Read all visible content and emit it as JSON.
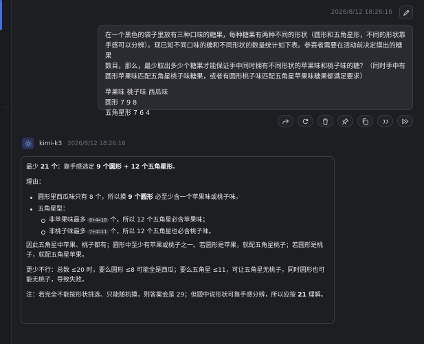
{
  "user_message": {
    "timestamp": "2026/8/12 18:26:16",
    "lines": [
      "在一个黑色的袋子里放有三种口味的糖果，每种糖果有两种不同的形状（圆形和五角星形，不同的形状靠",
      "手感可以分辨）。现已知不同口味的糖和不同形状的数量统计如下表。参赛者需要在活动前决定摸出的糖果",
      "数目，那么，最少取出多少个糖果才能保证手中同时拥有不同形状的苹果味和桃子味的糖？（同时手中有",
      "圆形苹果味匹配五角星桃子味糖果，或者有圆形桃子味匹配五角星苹果味糖果都满足要求）"
    ],
    "table_lines": [
      "苹果味 桃子味 西瓜味",
      "圆形 7 9 8",
      "五角星形 7 6 4"
    ]
  },
  "actions": [
    "share-icon",
    "refresh-icon",
    "trash-icon",
    "pin-icon",
    "copy-icon",
    "quote-icon",
    "forward-icon"
  ],
  "bot": {
    "name": "kimi-k3",
    "timestamp": "2026/8/12 18:26:16",
    "answer": {
      "p1_a": "最少 ",
      "p1_b": "21 个",
      "p1_c": "：靠手感选定 ",
      "p1_d": "9 个圆形 + 12 个五角星形",
      "p1_e": "。",
      "reason_label": "理由：",
      "b1_a": "圆形里西瓜味只有 8 个，所以摸 ",
      "b1_b": "9 个圆形",
      "b1_c": " 必至少含一个苹果味或桃子味。",
      "b2": "五角星型：",
      "b2a_a": "非苹果味最多",
      "b2a_code": "6+4=10",
      "b2a_b": "个，所以 12 个五角星必含苹果味；",
      "b2b_a": "非桃子味最多",
      "b2b_code": "7+4=11",
      "b2b_b": "个，所以 12 个五角星也必含桃子味。",
      "p3": "因此五角星中苹果、桃子都有；圆形中至少有苹果或桃子之一。若圆形是苹果，就配五角星桃子；若圆形是桃子，就配五角星苹果。",
      "p4": "更少不行：总数 ≤20 时，要么圆形 ≤8 可能全是西瓜；要么五角星 ≤11，可让五角星无桃子，同时圆形也可能无桃子，导致失败。",
      "p5_a": "注：若完全不能按形状挑选、只能随机摸，则答案会是 29；但题中说形状可靠手感分辨，所以应按 ",
      "p5_b": "21",
      "p5_c": " 理解。"
    }
  }
}
